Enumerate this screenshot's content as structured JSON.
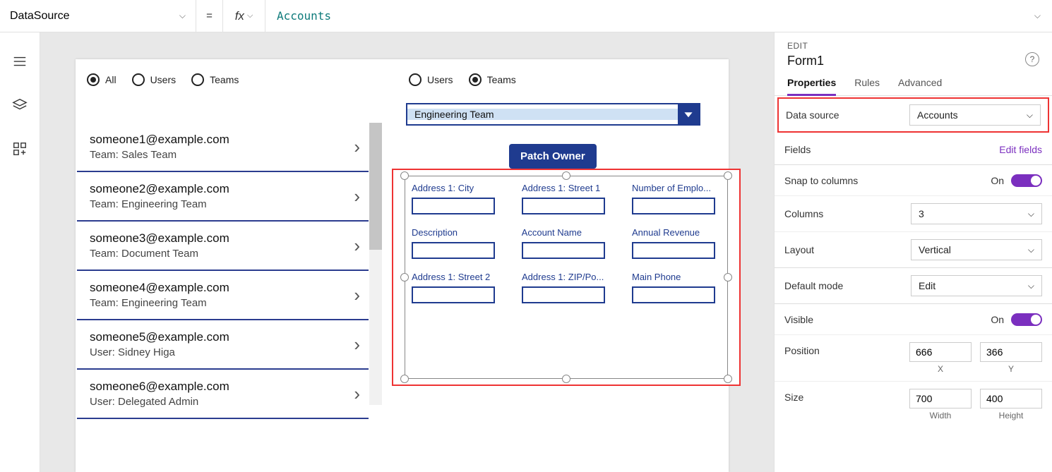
{
  "formulaBar": {
    "property": "DataSource",
    "eq": "=",
    "fx": "fx",
    "value": "Accounts"
  },
  "leftRail": {
    "icons": [
      "hamburger",
      "layers",
      "components"
    ]
  },
  "app": {
    "leftRadios": [
      {
        "label": "All",
        "selected": true
      },
      {
        "label": "Users",
        "selected": false
      },
      {
        "label": "Teams",
        "selected": false
      }
    ],
    "rightRadios": [
      {
        "label": "Users",
        "selected": false
      },
      {
        "label": "Teams",
        "selected": true
      }
    ],
    "listItems": [
      {
        "title": "someone1@example.com",
        "sub": "Team: Sales Team"
      },
      {
        "title": "someone2@example.com",
        "sub": "Team: Engineering Team"
      },
      {
        "title": "someone3@example.com",
        "sub": "Team: Document Team"
      },
      {
        "title": "someone4@example.com",
        "sub": "Team: Engineering Team"
      },
      {
        "title": "someone5@example.com",
        "sub": "User: Sidney Higa"
      },
      {
        "title": "someone6@example.com",
        "sub": "User: Delegated Admin"
      }
    ],
    "teamDropdown": "Engineering Team",
    "patchButton": "Patch Owner",
    "formFields": [
      {
        "label": "Address 1: City",
        "required": false
      },
      {
        "label": "Address 1: Street 1",
        "required": false
      },
      {
        "label": "Number of Emplo...",
        "required": false
      },
      {
        "label": "Description",
        "required": false
      },
      {
        "label": "Account Name",
        "required": true
      },
      {
        "label": "Annual Revenue",
        "required": false
      },
      {
        "label": "Address 1: Street 2",
        "required": false
      },
      {
        "label": "Address 1: ZIP/Po...",
        "required": false
      },
      {
        "label": "Main Phone",
        "required": false
      }
    ]
  },
  "props": {
    "editLabel": "EDIT",
    "title": "Form1",
    "tabs": {
      "properties": "Properties",
      "rules": "Rules",
      "advanced": "Advanced"
    },
    "rows": {
      "dataSourceLabel": "Data source",
      "dataSourceValue": "Accounts",
      "fieldsLabel": "Fields",
      "editFields": "Edit fields",
      "snapLabel": "Snap to columns",
      "snapValue": "On",
      "columnsLabel": "Columns",
      "columnsValue": "3",
      "layoutLabel": "Layout",
      "layoutValue": "Vertical",
      "defaultModeLabel": "Default mode",
      "defaultModeValue": "Edit",
      "visibleLabel": "Visible",
      "visibleValue": "On",
      "positionLabel": "Position",
      "posX": "666",
      "posXCap": "X",
      "posY": "366",
      "posYCap": "Y",
      "sizeLabel": "Size",
      "sizeW": "700",
      "sizeWCap": "Width",
      "sizeH": "400",
      "sizeHCap": "Height"
    }
  }
}
